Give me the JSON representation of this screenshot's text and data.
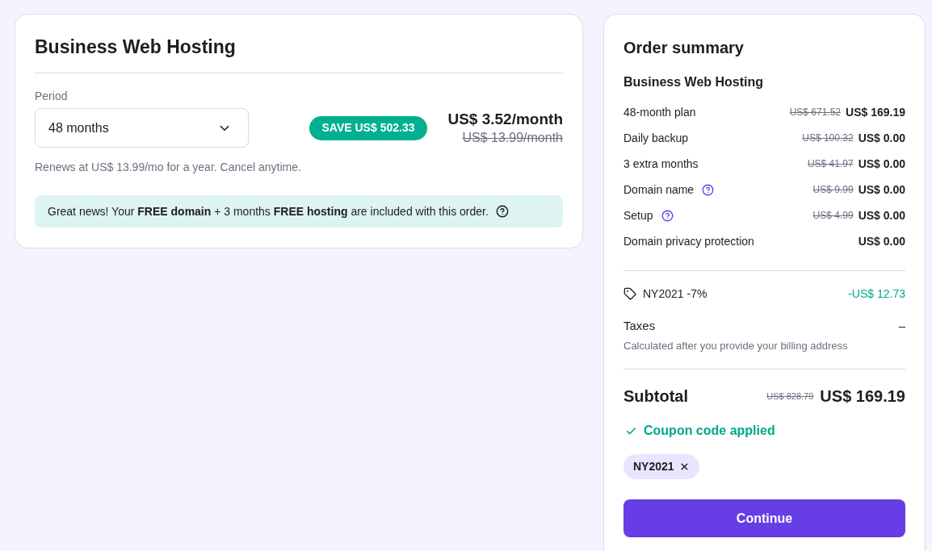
{
  "plan_card": {
    "title": "Business Web Hosting",
    "period": {
      "label": "Period",
      "value": "48 months"
    },
    "save_badge": "SAVE US$ 502.33",
    "price": "US$ 3.52/month",
    "old_price": "US$ 13.99/month",
    "renewal_note": "Renews at US$ 13.99/mo for a year. Cancel anytime.",
    "notice": "Great news! Your **FREE domain** + 3 months **FREE hosting** are included with this order."
  },
  "order_summary": {
    "title": "Order summary",
    "product": "Business Web Hosting",
    "items": [
      {
        "label": "48-month plan",
        "help_icon": false,
        "old_price": "US$ 671.52",
        "price": "US$ 169.19"
      },
      {
        "label": "Daily backup",
        "help_icon": false,
        "old_price": "US$ 100.32",
        "price": "US$ 0.00"
      },
      {
        "label": "3 extra months",
        "help_icon": false,
        "old_price": "US$ 41.97",
        "price": "US$ 0.00"
      },
      {
        "label": "Domain name",
        "help_icon": true,
        "old_price": "US$ 9.99",
        "price": "US$ 0.00"
      },
      {
        "label": "Setup",
        "help_icon": true,
        "old_price": "US$ 4.99",
        "price": "US$ 0.00"
      },
      {
        "label": "Domain privacy protection",
        "help_icon": false,
        "price": "US$ 0.00"
      }
    ],
    "discount": {
      "label": "NY2021 -7%",
      "amount": "-US$ 12.73"
    },
    "taxes": {
      "label": "Taxes",
      "value": "–",
      "note": "Calculated after you provide your billing address"
    },
    "subtotal": {
      "label": "Subtotal",
      "old_price": "US$ 828.79",
      "price": "US$ 169.19"
    },
    "coupon_status": "Coupon code applied",
    "coupon_chip": "NY2021",
    "continue_button": "Continue"
  }
}
